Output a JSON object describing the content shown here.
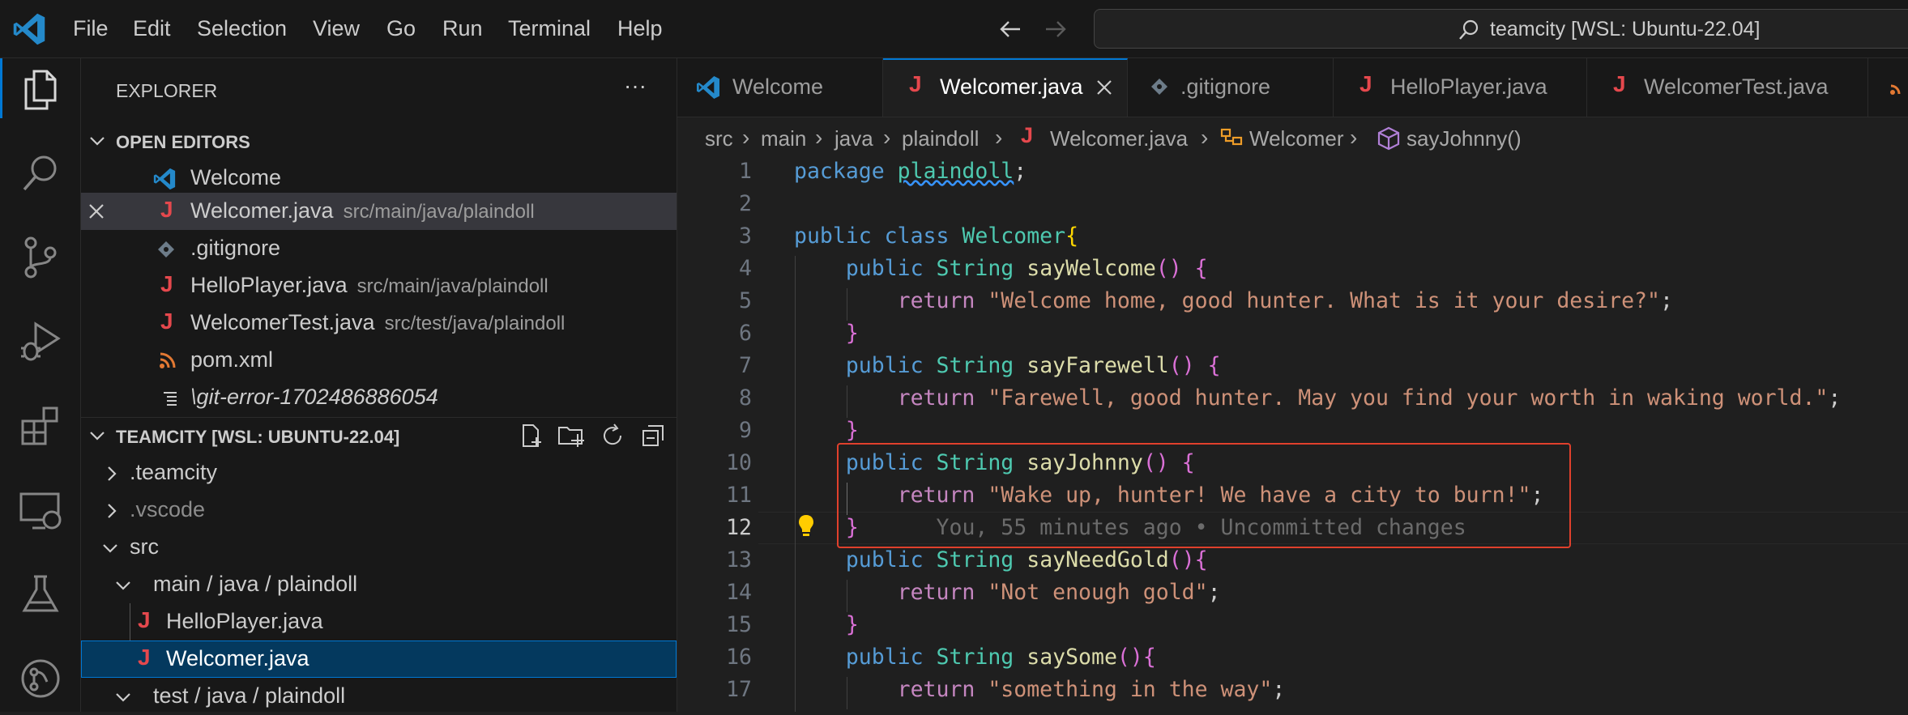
{
  "menu": [
    "File",
    "Edit",
    "Selection",
    "View",
    "Go",
    "Run",
    "Terminal",
    "Help"
  ],
  "command_center": {
    "text": "teamcity [WSL: Ubuntu-22.04]"
  },
  "activity_bar": [
    "explorer-icon",
    "search-icon",
    "source-control-icon",
    "run-debug-icon",
    "extensions-icon",
    "remote-explorer-icon",
    "testing-icon",
    "remote-status-icon"
  ],
  "sidebar": {
    "title": "EXPLORER",
    "more": "···",
    "open_editors": {
      "header": "OPEN EDITORS",
      "items": [
        {
          "name": "Welcome",
          "desc": ""
        },
        {
          "name": "Welcomer.java",
          "desc": "src/main/java/plaindoll"
        },
        {
          "name": ".gitignore",
          "desc": ""
        },
        {
          "name": "HelloPlayer.java",
          "desc": "src/main/java/plaindoll"
        },
        {
          "name": "WelcomerTest.java",
          "desc": "src/test/java/plaindoll"
        },
        {
          "name": "pom.xml",
          "desc": ""
        },
        {
          "name": "\\git-error-1702486886054",
          "desc": ""
        }
      ]
    },
    "workspace": {
      "header": "TEAMCITY [WSL: UBUNTU-22.04]",
      "tree": [
        ".teamcity",
        ".vscode",
        "src",
        "main / java / plaindoll",
        "HelloPlayer.java",
        "Welcomer.java",
        "test / java / plaindoll"
      ]
    }
  },
  "tabs": [
    "Welcome",
    "Welcomer.java",
    ".gitignore",
    "HelloPlayer.java",
    "WelcomerTest.java"
  ],
  "breadcrumb": [
    "src",
    "main",
    "java",
    "plaindoll",
    "Welcomer.java",
    "Welcomer",
    "sayJohnny()"
  ],
  "code": {
    "l1": [
      "package",
      "plaindoll",
      ";"
    ],
    "class_decl": [
      "public class",
      "Welcomer",
      "{"
    ],
    "public": "public",
    "string": "String",
    "ret": "return",
    "methods": [
      {
        "name": "sayWelcome",
        "sig": "()",
        "open": " {",
        "str": "\"Welcome home, good hunter. What is it your desire?\""
      },
      {
        "name": "sayFarewell",
        "sig": "()",
        "open": " {",
        "str": "\"Farewell, good hunter. May you find your worth in waking world.\""
      },
      {
        "name": "sayJohnny",
        "sig": "()",
        "open": " {",
        "str": "\"Wake up, hunter! We have a city to burn!\""
      },
      {
        "name": "sayNeedGold",
        "sig": "()",
        "open": "{",
        "str": "\"Not enough gold\""
      },
      {
        "name": "saySome",
        "sig": "()",
        "open": "{",
        "str": "\"something in the way\""
      }
    ],
    "blame": "You, 55 minutes ago • Uncommitted changes",
    "line_numbers": [
      "1",
      "2",
      "3",
      "4",
      "5",
      "6",
      "7",
      "8",
      "9",
      "10",
      "11",
      "12",
      "13",
      "14",
      "15",
      "16",
      "17"
    ],
    "current_line": "12"
  },
  "colors": {
    "accent": "#0078d4",
    "java_icon": "#e5484d",
    "highlight_box": "#e0402c",
    "selected_row": "#04395e"
  }
}
